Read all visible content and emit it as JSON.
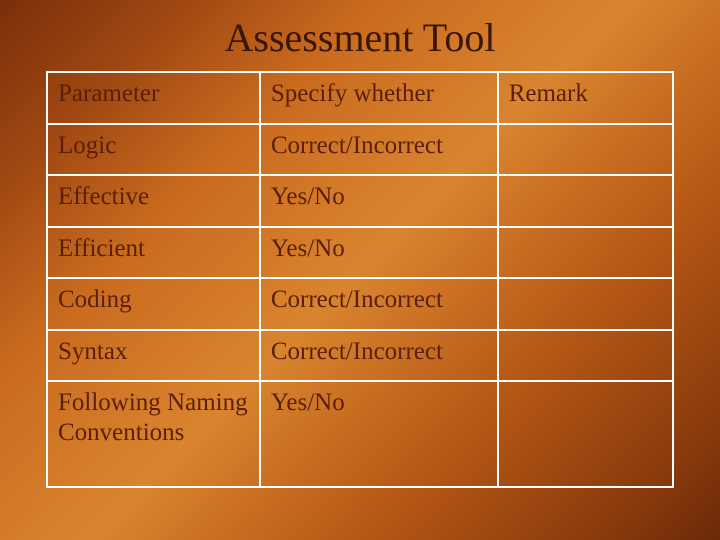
{
  "title": "Assessment Tool",
  "headers": {
    "c1": "Parameter",
    "c2": "Specify whether",
    "c3": "Remark"
  },
  "rows": [
    {
      "param": "Logic",
      "spec": "Correct/Incorrect",
      "remark": ""
    },
    {
      "param": "Effective",
      "spec": "Yes/No",
      "remark": ""
    },
    {
      "param": "Efficient",
      "spec": "Yes/No",
      "remark": ""
    },
    {
      "param": "Coding",
      "spec": "Correct/Incorrect",
      "remark": ""
    },
    {
      "param": "Syntax",
      "spec": "Correct/Incorrect",
      "remark": ""
    },
    {
      "param": "Following Naming Conventions",
      "spec": "Yes/No",
      "remark": ""
    }
  ],
  "chart_data": {
    "type": "table",
    "columns": [
      "Parameter",
      "Specify whether",
      "Remark"
    ],
    "rows": [
      [
        "Logic",
        "Correct/Incorrect",
        ""
      ],
      [
        "Effective",
        "Yes/No",
        ""
      ],
      [
        "Efficient",
        "Yes/No",
        ""
      ],
      [
        "Coding",
        "Correct/Incorrect",
        ""
      ],
      [
        "Syntax",
        "Correct/Incorrect",
        ""
      ],
      [
        "Following Naming Conventions",
        "Yes/No",
        ""
      ]
    ],
    "title": "Assessment Tool"
  }
}
